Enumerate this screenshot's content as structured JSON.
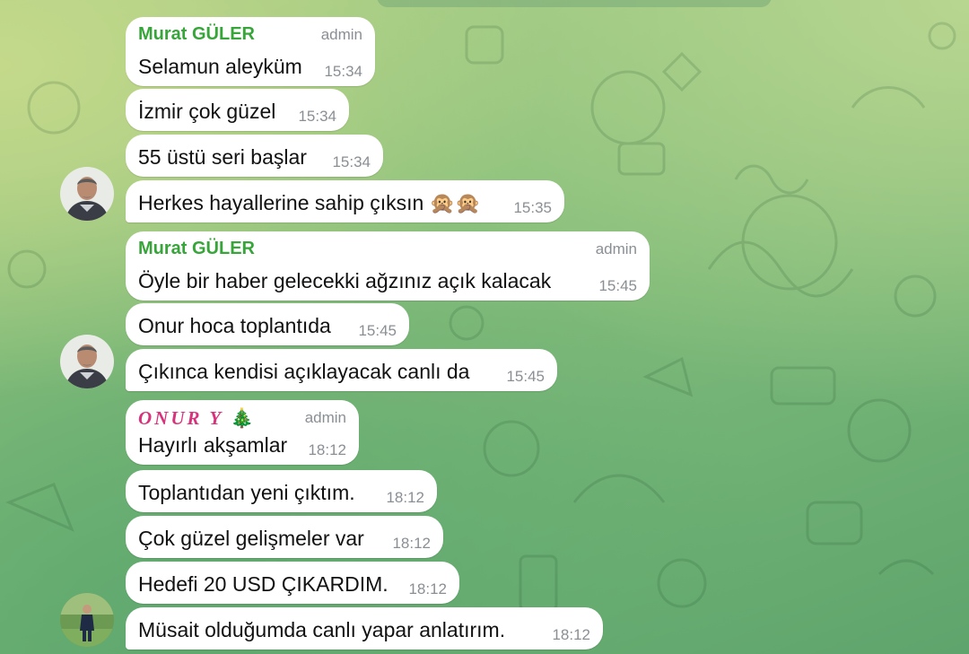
{
  "messages": [
    {
      "sender": "Murat GÜLER",
      "role": "admin",
      "text": "Selamun aleyküm",
      "time": "15:34"
    },
    {
      "text": "İzmir çok güzel",
      "time": "15:34"
    },
    {
      "text": "55 üstü seri başlar",
      "time": "15:34"
    },
    {
      "text": "Herkes hayallerine sahip çıksın 🙊🙊",
      "time": "15:35"
    },
    {
      "sender": "Murat GÜLER",
      "role": "admin",
      "text": "Öyle bir haber gelecekki ağzınız açık  kalacak",
      "time": "15:45"
    },
    {
      "text": "Onur hoca toplantıda",
      "time": "15:45"
    },
    {
      "text": "Çıkınca kendisi açıklayacak canlı da",
      "time": "15:45"
    },
    {
      "sender": "ONUR Y",
      "sender_emoji": "🎄",
      "role": "admin",
      "text": "Hayırlı akşamlar",
      "time": "18:12"
    },
    {
      "text": "Toplantıdan yeni çıktım.",
      "time": "18:12"
    },
    {
      "text": "Çok güzel gelişmeler var",
      "time": "18:12"
    },
    {
      "text": "Hedefi 20 USD ÇIKARDIM.",
      "time": "18:12"
    },
    {
      "text": "Müsait olduğumda canlı yapar anlatırım.",
      "time": "18:12"
    }
  ],
  "colors": {
    "sender_name": "#37a53a",
    "fancy_sender_name": "#d6337c",
    "bubble": "#ffffff",
    "meta": "#8a8f94"
  },
  "icons": [
    "user-avatar-murat",
    "user-avatar-onur",
    "wallpaper-doodles",
    "christmas-tree-emoji",
    "monkey-emoji"
  ]
}
